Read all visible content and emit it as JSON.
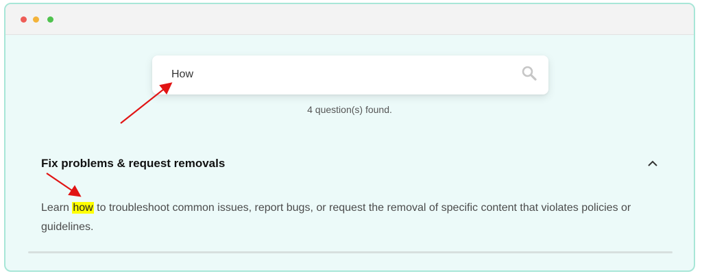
{
  "search": {
    "value": "How",
    "icon": "search-icon"
  },
  "results": {
    "count_text": "4 question(s) found."
  },
  "faq": {
    "title": "Fix problems & request removals",
    "answer_prefix": "Learn ",
    "answer_highlight": "how",
    "answer_suffix": " to troubleshoot common issues, report bugs, or request the removal of specific content that violates policies or guidelines."
  },
  "colors": {
    "highlight": "#ffff00",
    "annotation_arrow": "#e11414",
    "page_background": "#ecfaf9"
  }
}
